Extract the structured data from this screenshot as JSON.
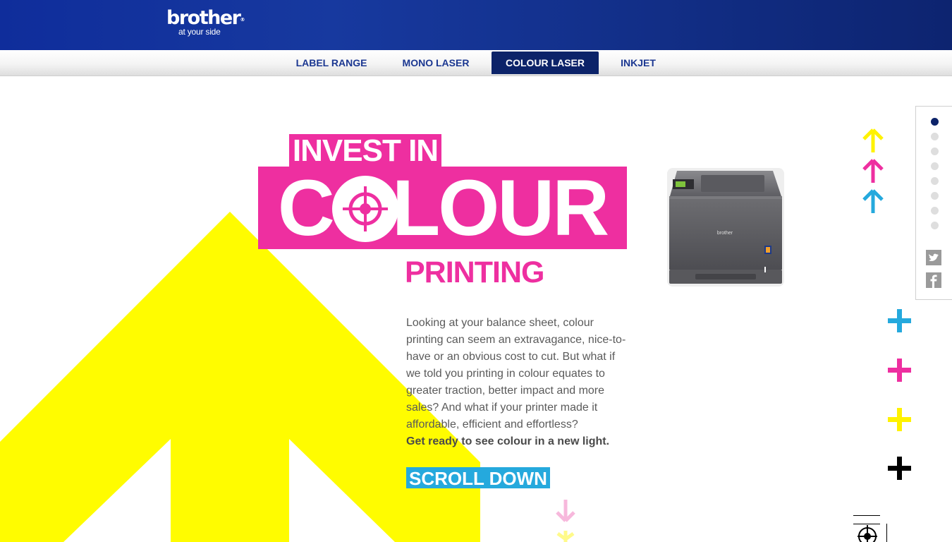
{
  "header": {
    "logo_main": "brother",
    "logo_tag": "at your side",
    "brand_color": "#0f2d9b"
  },
  "nav": {
    "items": [
      {
        "label": "LABEL RANGE",
        "active": false
      },
      {
        "label": "MONO LASER",
        "active": false
      },
      {
        "label": "COLOUR LASER",
        "active": true
      },
      {
        "label": "INKJET",
        "active": false
      }
    ]
  },
  "hero": {
    "line1": "INVEST IN",
    "line2": "COLOUR",
    "line3": "PRINTING",
    "accent_color": "#ee2fa0",
    "body": "Looking at your balance sheet, colour printing can seem an extravagance, nice-to-have or an obvious cost to cut. But what if we told you printing in colour equates to greater traction, better impact and more sales? And what if your printer made it affordable, efficient and effortless?",
    "body_strong": "Get ready to see colour in a new light.",
    "cta": "SCROLL DOWN",
    "cta_color": "#25a9dd"
  },
  "printer": {
    "brand": "brother"
  },
  "decor": {
    "arrow_colors": [
      "#fff200",
      "#ee2fa0",
      "#25a9dd"
    ],
    "plus_colors": [
      "#25a9dd",
      "#ee2fa0",
      "#fff200",
      "#000000"
    ],
    "big_arrow_color": "#fffc00"
  },
  "sidebar": {
    "dot_count": 8,
    "active_dot": 0,
    "social": [
      "twitter-icon",
      "facebook-icon"
    ]
  }
}
